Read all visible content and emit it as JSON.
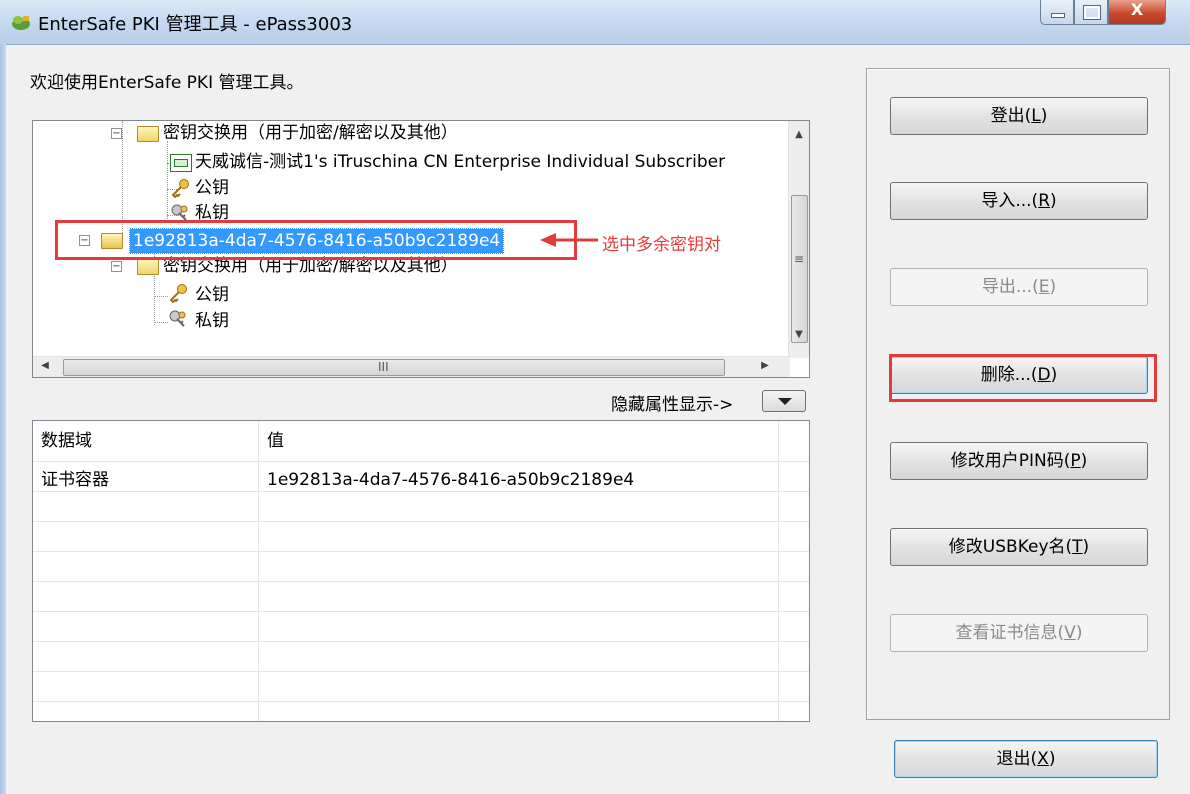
{
  "window": {
    "title": "EnterSafe PKI 管理工具 - ePass3003",
    "close_glyph": "X"
  },
  "welcome_text": "欢迎使用EnterSafe PKI 管理工具。",
  "tree": {
    "items": [
      {
        "label": "密钥交换用（用于加密/解密以及其他）",
        "icon": "folder-icon"
      },
      {
        "label": "天威诚信-测试1's iTruschina CN Enterprise Individual Subscriber",
        "icon": "certificate-icon"
      },
      {
        "label": "公钥",
        "icon": "public-key-icon"
      },
      {
        "label": "私钥",
        "icon": "private-key-icon"
      },
      {
        "label": "1e92813a-4da7-4576-8416-a50b9c2189e4",
        "icon": "folder-open-icon",
        "selected": true
      },
      {
        "label": "密钥交换用（用于加密/解密以及其他）",
        "icon": "folder-icon"
      },
      {
        "label": "公钥",
        "icon": "public-key-icon"
      },
      {
        "label": "私钥",
        "icon": "private-key-icon"
      }
    ],
    "annotation": "选中多余密钥对",
    "expander_glyph": "−",
    "hscroll_grip": "III",
    "vscroll_grip": "≡"
  },
  "toggle": {
    "label": "隐藏属性显示->"
  },
  "grid": {
    "headers": [
      "数据域",
      "值"
    ],
    "rows": [
      {
        "field": "证书容器",
        "value": "1e92813a-4da7-4576-8416-a50b9c2189e4"
      }
    ]
  },
  "buttons": {
    "logout": {
      "label": "登出(",
      "key": "L",
      "suffix": ")"
    },
    "import": {
      "label": "导入...(",
      "key": "R",
      "suffix": ")"
    },
    "export": {
      "label": "导出...(",
      "key": "E",
      "suffix": ")"
    },
    "delete": {
      "label": "删除...(",
      "key": "D",
      "suffix": ")"
    },
    "change_pin": {
      "label": "修改用户PIN码(",
      "key": "P",
      "suffix": ")"
    },
    "rename": {
      "label": "修改USBKey名(",
      "key": "T",
      "suffix": ")"
    },
    "view_cert": {
      "label": "查看证书信息(",
      "key": "V",
      "suffix": ")"
    },
    "exit": {
      "label": "退出(",
      "key": "X",
      "suffix": ")"
    }
  },
  "colors": {
    "selection": "#3399ff",
    "annotation_red": "#e23b3b"
  }
}
